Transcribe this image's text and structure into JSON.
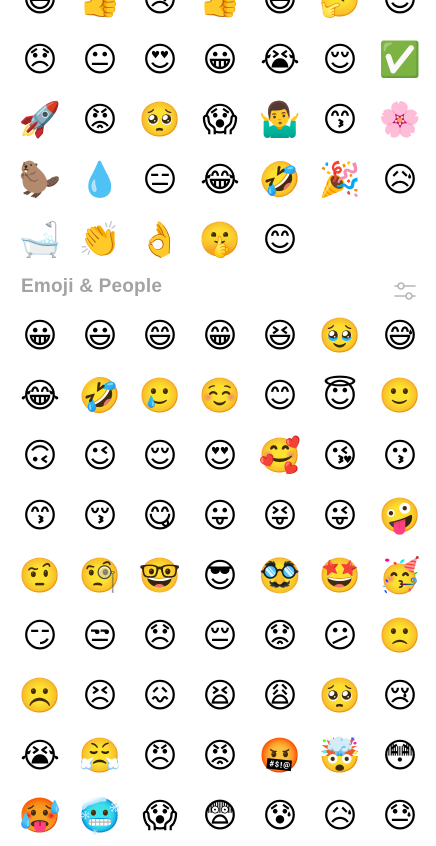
{
  "recent_emojis": [
    "😅",
    "👍",
    "😢",
    "👍",
    "😄",
    "🤔",
    "😉",
    "😞",
    "😐",
    "😍",
    "😀",
    "😭",
    "😌",
    "✅",
    "🚀",
    "😡",
    "🥺",
    "😱",
    "🤷‍♂️",
    "😙",
    "🌸",
    "🦫",
    "💧",
    "😑",
    "😂",
    "🤣",
    "🎉",
    "😥",
    "🛁",
    "👏",
    "👌",
    "🤫",
    "😊"
  ],
  "section": {
    "title": "Emoji & People",
    "filter_icon": "sliders-icon",
    "accent_color": "#a3a3a3"
  },
  "people_emojis": [
    "😀",
    "😃",
    "😄",
    "😁",
    "😆",
    "🥹",
    "😅",
    "😂",
    "🤣",
    "🥲",
    "☺️",
    "😊",
    "😇",
    "🙂",
    "🙃",
    "😉",
    "😌",
    "😍",
    "🥰",
    "😘",
    "😗",
    "😙",
    "😚",
    "😋",
    "😛",
    "😝",
    "😜",
    "🤪",
    "🤨",
    "🧐",
    "🤓",
    "😎",
    "🥸",
    "🤩",
    "🥳",
    "😏",
    "😒",
    "😞",
    "😔",
    "😟",
    "😕",
    "🙁",
    "☹️",
    "😣",
    "😖",
    "😫",
    "😩",
    "🥺",
    "😢",
    "😭",
    "😤",
    "😠",
    "😡",
    "🤬",
    "🤯",
    "😳",
    "🥵",
    "🥶",
    "😱",
    "😨",
    "😰",
    "😥",
    "😓"
  ]
}
